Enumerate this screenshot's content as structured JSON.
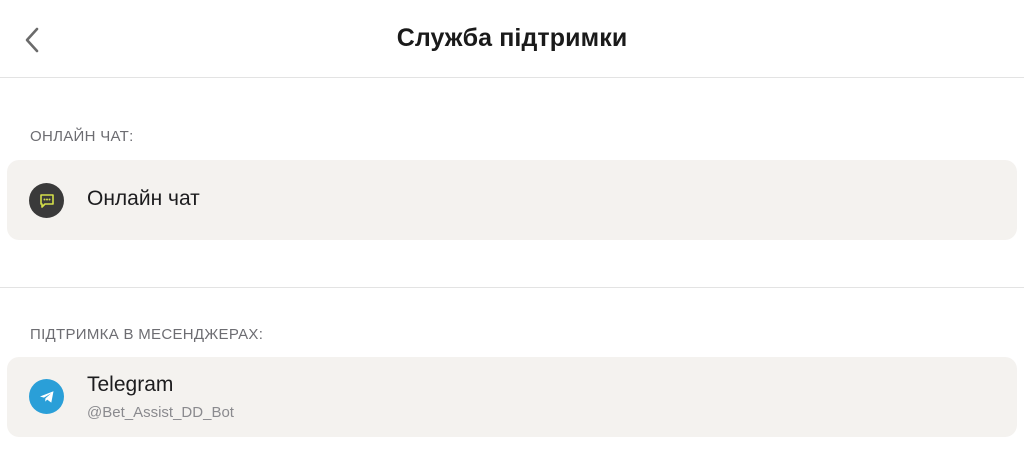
{
  "header": {
    "title": "Служба підтримки",
    "back_icon": "chevron-left-icon"
  },
  "sections": [
    {
      "label": "ОНЛАЙН ЧАТ:",
      "items": [
        {
          "title": "Онлайн чат",
          "icon": "chat-bubble-icon",
          "icon_bg": "#3a3a3a",
          "icon_color": "#d4e04a"
        }
      ]
    },
    {
      "label": "ПІДТРИМКА В МЕСЕНДЖЕРАХ:",
      "items": [
        {
          "title": "Telegram",
          "subtitle": "@Bet_Assist_DD_Bot",
          "icon": "telegram-icon",
          "icon_bg": "#2a9fd8",
          "icon_color": "#ffffff"
        }
      ]
    }
  ]
}
